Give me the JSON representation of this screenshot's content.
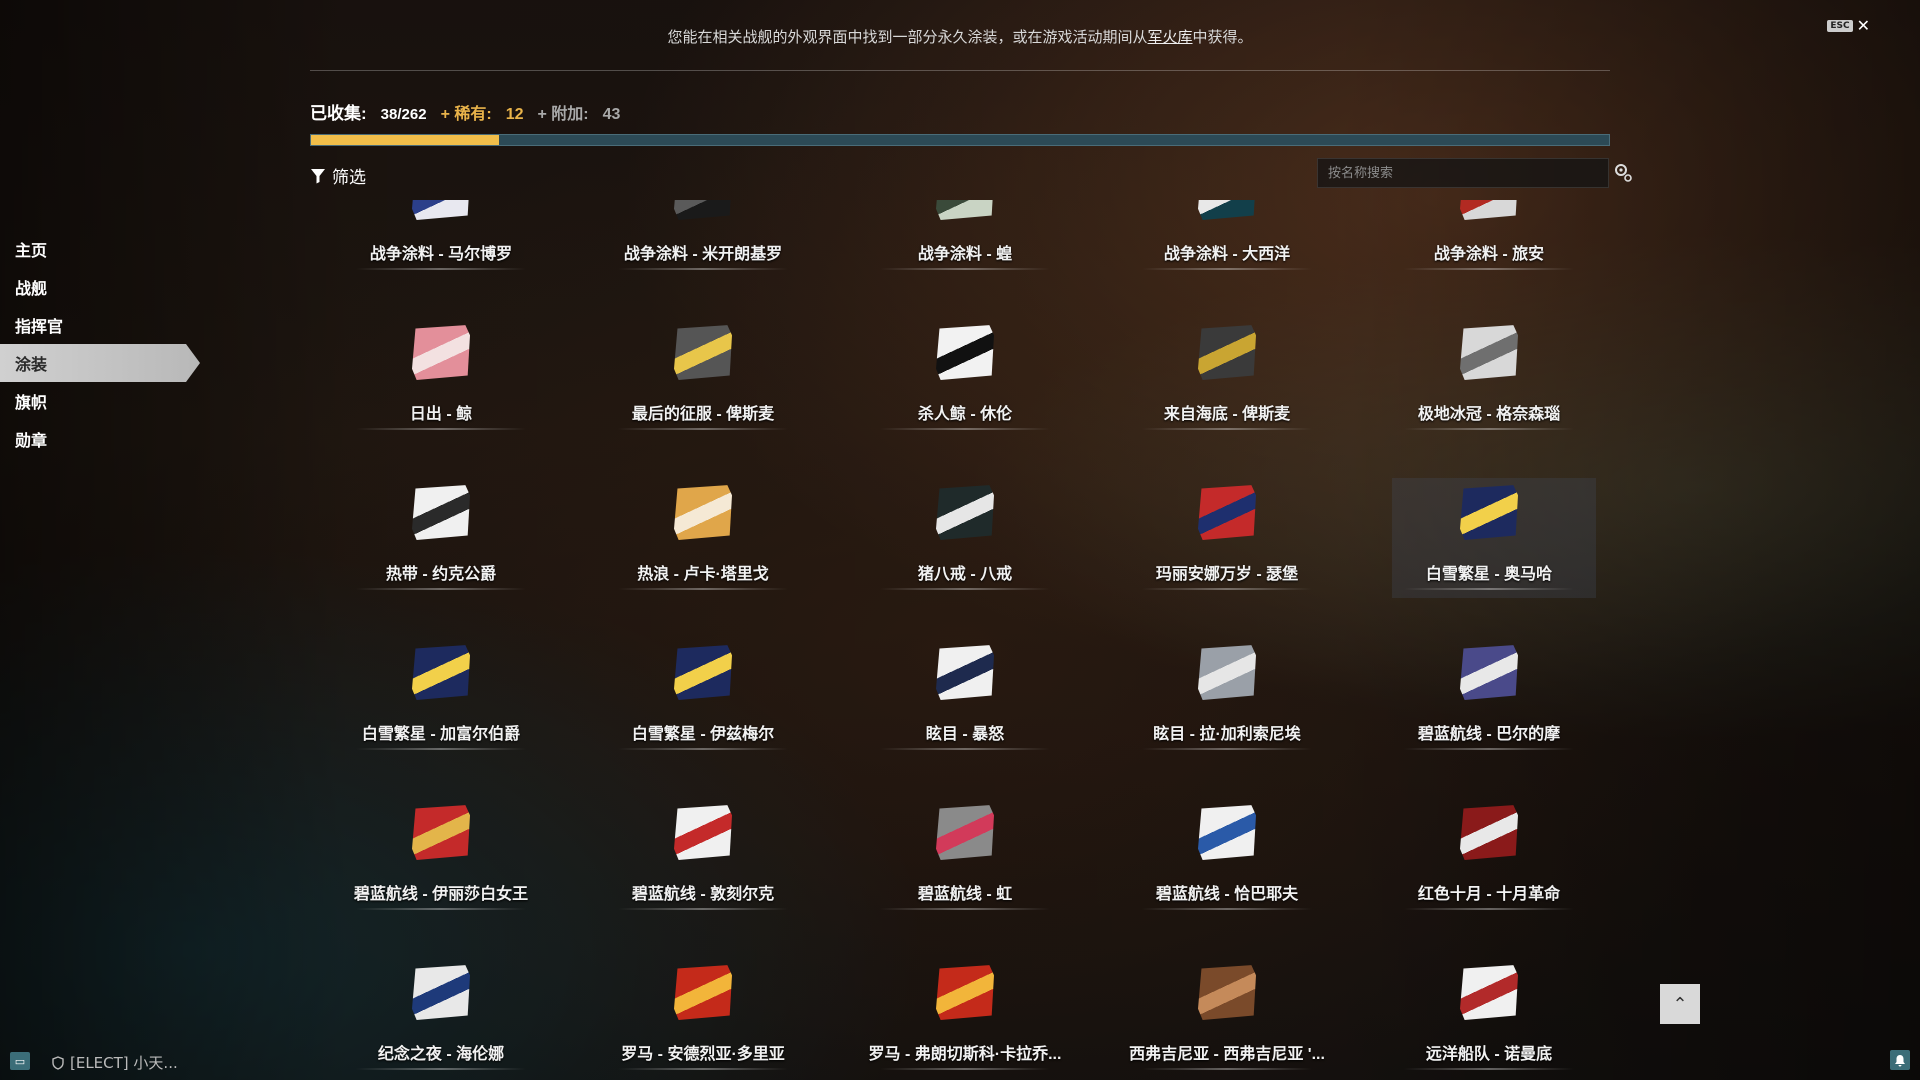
{
  "header": {
    "notice_pre": "您能在相关战舰的外观界面中找到一部分永久涂装，或在游戏活动期间从",
    "notice_link": "军火库",
    "notice_post": "中获得。",
    "esc_label": "ESC",
    "close_glyph": "✕"
  },
  "stats": {
    "collected_label": "已收集:",
    "collected_value": "38/262",
    "rare_label": "+ 稀有:",
    "rare_value": "12",
    "extra_label": "+ 附加:",
    "extra_value": "43",
    "progress_fraction": 0.145,
    "progress_color": "#f1be4a",
    "track_color": "#2c4a56"
  },
  "toolbar": {
    "filter_label": "筛选",
    "search_placeholder": "按名称搜索"
  },
  "sidebar": {
    "items": [
      {
        "label": "主页",
        "active": false
      },
      {
        "label": "战舰",
        "active": false
      },
      {
        "label": "指挥官",
        "active": false
      },
      {
        "label": "涂装",
        "active": true
      },
      {
        "label": "旗帜",
        "active": false
      },
      {
        "label": "勋章",
        "active": false
      }
    ]
  },
  "camos": [
    {
      "name": "战争涂料 - 马尔博罗",
      "icon": "blue-white-flag-icon",
      "colors": [
        "#e8e8f0",
        "#2b3f8a"
      ]
    },
    {
      "name": "战争涂料 - 米开朗基罗",
      "icon": "dark-band-icon",
      "colors": [
        "#1a1a1a",
        "#5a5a5a"
      ]
    },
    {
      "name": "战争涂料 - 蝗",
      "icon": "stone-pattern-icon",
      "colors": [
        "#c9d4c4",
        "#3a4a3a"
      ]
    },
    {
      "name": "战争涂料 - 大西洋",
      "icon": "teal-wave-icon",
      "colors": [
        "#123f4a",
        "#e8e8e8"
      ]
    },
    {
      "name": "战争涂料 - 旅安",
      "icon": "red-stripe-icon",
      "colors": [
        "#d8d8d8",
        "#b22a22"
      ]
    },
    {
      "name": "日出 - 鲸",
      "icon": "pink-blossom-icon",
      "colors": [
        "#e38f9a",
        "#f3e1e1"
      ]
    },
    {
      "name": "最后的征服 - 俾斯麦",
      "icon": "yellow-lightning-icon",
      "colors": [
        "#555555",
        "#e8c64a"
      ]
    },
    {
      "name": "杀人鲸 - 休伦",
      "icon": "orca-icon",
      "colors": [
        "#f2f2f2",
        "#111111"
      ]
    },
    {
      "name": "来自海底 - 俾斯麦",
      "icon": "golden-rust-icon",
      "colors": [
        "#3a3a3a",
        "#c9a532"
      ]
    },
    {
      "name": "极地冰冠 - 格奈森瑙",
      "icon": "ice-peak-icon",
      "colors": [
        "#d8d8d8",
        "#6f6f6f"
      ]
    },
    {
      "name": "热带 - 约克公爵",
      "icon": "tropical-wave-icon",
      "colors": [
        "#f0f0f0",
        "#2a2a2a"
      ]
    },
    {
      "name": "热浪 - 卢卡·塔里戈",
      "icon": "heatwave-icon",
      "colors": [
        "#e0a64a",
        "#f5e9d5"
      ]
    },
    {
      "name": "猪八戒 - 八戒",
      "icon": "dragon-cloud-icon",
      "colors": [
        "#1f2a2a",
        "#e6e6e6"
      ]
    },
    {
      "name": "玛丽安娜万岁 - 瑟堡",
      "icon": "tricolor-icon",
      "colors": [
        "#c42a2a",
        "#1e2f6e"
      ]
    },
    {
      "name": "白雪繁星 - 奥马哈",
      "icon": "starry-night-icon",
      "colors": [
        "#1d2a5e",
        "#f2d04a"
      ],
      "highlight": true
    },
    {
      "name": "白雪繁星 - 加富尔伯爵",
      "icon": "starry-night-icon",
      "colors": [
        "#1d2a5e",
        "#f2d04a"
      ]
    },
    {
      "name": "白雪繁星 - 伊兹梅尔",
      "icon": "starry-night-icon",
      "colors": [
        "#1d2a5e",
        "#f2d04a"
      ]
    },
    {
      "name": "眩目 - 暴怒",
      "icon": "dazzle-stripe-icon",
      "colors": [
        "#f0f0f0",
        "#1e2a4e"
      ]
    },
    {
      "name": "眩目 - 拉·加利索尼埃",
      "icon": "dazzle-band-icon",
      "colors": [
        "#9aa0a8",
        "#e6e6e6"
      ]
    },
    {
      "name": "碧蓝航线 - 巴尔的摩",
      "icon": "number-68-icon",
      "colors": [
        "#4a4a8a",
        "#e8e8e8"
      ]
    },
    {
      "name": "碧蓝航线 - 伊丽莎白女王",
      "icon": "royal-crest-icon",
      "colors": [
        "#c42a2a",
        "#e3b54a"
      ]
    },
    {
      "name": "碧蓝航线 - 敦刻尔克",
      "icon": "cross-flag-icon",
      "colors": [
        "#f0f0f0",
        "#c42a2a"
      ]
    },
    {
      "name": "碧蓝航线 - 虹",
      "icon": "grey-rays-icon",
      "colors": [
        "#8a8a8a",
        "#d23a5a"
      ]
    },
    {
      "name": "碧蓝航线 - 恰巴耶夫",
      "icon": "snow-sail-icon",
      "colors": [
        "#f0f0f0",
        "#2a5aa8"
      ]
    },
    {
      "name": "红色十月 - 十月革命",
      "icon": "red-october-icon",
      "colors": [
        "#8a1a1a",
        "#e8e8e8"
      ]
    },
    {
      "name": "纪念之夜 - 海伦娜",
      "icon": "eagle-night-icon",
      "colors": [
        "#e8e8e8",
        "#1e3a7a"
      ]
    },
    {
      "name": "罗马 - 安德烈亚·多里亚",
      "icon": "roman-sun-icon",
      "colors": [
        "#c42a1a",
        "#f2b53a"
      ]
    },
    {
      "name": "罗马 - 弗朗切斯科·卡拉乔...",
      "icon": "roman-sun-icon",
      "colors": [
        "#c42a1a",
        "#f2b53a"
      ]
    },
    {
      "name": "西弗吉尼亚 - 西弗吉尼亚 '...",
      "icon": "brown-swirl-icon",
      "colors": [
        "#7a4a2a",
        "#c58a5a"
      ]
    },
    {
      "name": "远洋船队 - 诺曼底",
      "icon": "fleet-stripe-icon",
      "colors": [
        "#f0f0f0",
        "#b22a2a"
      ]
    }
  ],
  "footer": {
    "clan_text": "[ELECT] 小天...",
    "scroll_top_glyph": "⌃"
  }
}
